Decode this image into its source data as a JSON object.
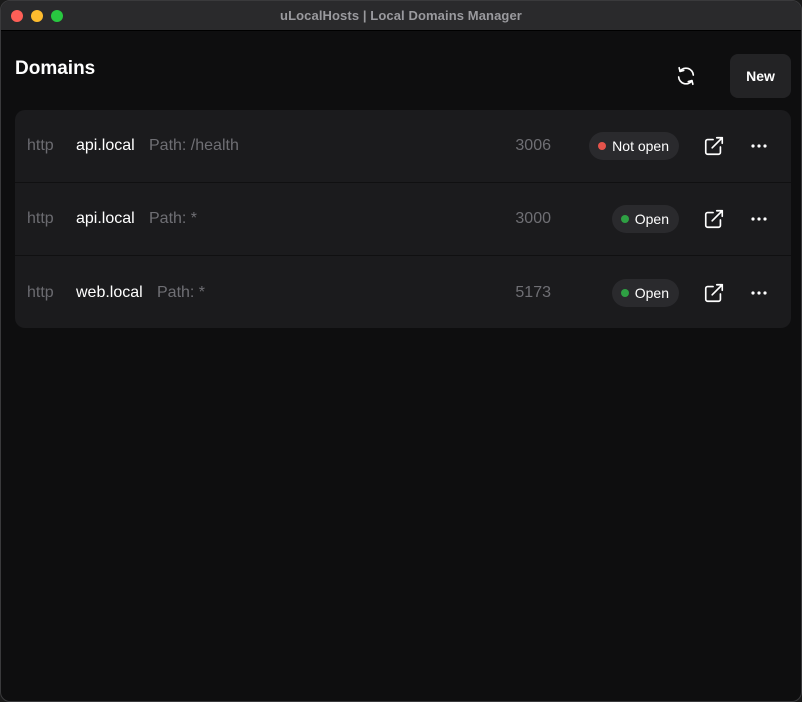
{
  "window": {
    "title": "uLocalHosts | Local Domains Manager"
  },
  "page": {
    "title": "Domains"
  },
  "toolbar": {
    "new_label": "New",
    "refresh_icon": "refresh-icon"
  },
  "colors": {
    "status_closed": "#e5534b",
    "status_open": "#2ea043",
    "background": "#0e0e0f",
    "card": "#1b1b1d"
  },
  "domains": [
    {
      "protocol": "http",
      "host": "api.local",
      "path": "Path: /health",
      "port": "3006",
      "status": "Not open",
      "status_state": "closed"
    },
    {
      "protocol": "http",
      "host": "api.local",
      "path": "Path: *",
      "port": "3000",
      "status": "Open",
      "status_state": "open"
    },
    {
      "protocol": "http",
      "host": "web.local",
      "path": "Path: *",
      "port": "5173",
      "status": "Open",
      "status_state": "open"
    }
  ]
}
